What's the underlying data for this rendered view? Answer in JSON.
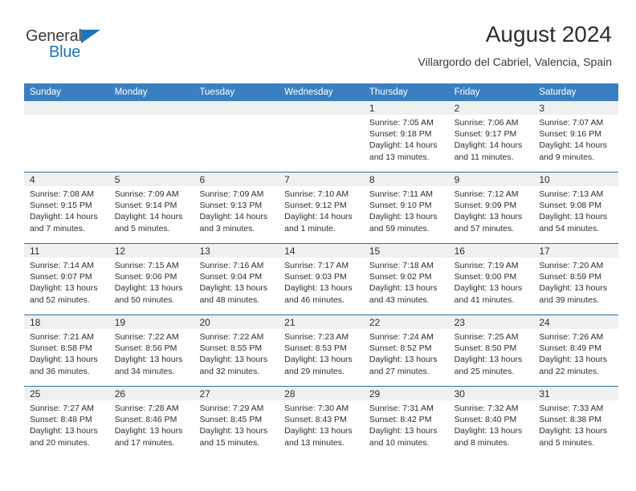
{
  "brand": {
    "name_top": "General",
    "name_bottom": "Blue",
    "triangle_color": "#1b75bb",
    "text_color": "#3d3d3d"
  },
  "header": {
    "title": "August 2024",
    "subtitle": "Villargordo del Cabriel, Valencia, Spain"
  },
  "colors": {
    "header_row_bg": "#3a7fc1",
    "header_row_text": "#ffffff",
    "daynum_band_bg": "#f0f0f0",
    "week_divider": "#2e6da4",
    "body_text": "#2f2f2f"
  },
  "weekdays": [
    "Sunday",
    "Monday",
    "Tuesday",
    "Wednesday",
    "Thursday",
    "Friday",
    "Saturday"
  ],
  "weeks": [
    [
      {
        "day": "",
        "lines": []
      },
      {
        "day": "",
        "lines": []
      },
      {
        "day": "",
        "lines": []
      },
      {
        "day": "",
        "lines": []
      },
      {
        "day": "1",
        "lines": [
          "Sunrise: 7:05 AM",
          "Sunset: 9:18 PM",
          "Daylight: 14 hours",
          "and 13 minutes."
        ]
      },
      {
        "day": "2",
        "lines": [
          "Sunrise: 7:06 AM",
          "Sunset: 9:17 PM",
          "Daylight: 14 hours",
          "and 11 minutes."
        ]
      },
      {
        "day": "3",
        "lines": [
          "Sunrise: 7:07 AM",
          "Sunset: 9:16 PM",
          "Daylight: 14 hours",
          "and 9 minutes."
        ]
      }
    ],
    [
      {
        "day": "4",
        "lines": [
          "Sunrise: 7:08 AM",
          "Sunset: 9:15 PM",
          "Daylight: 14 hours",
          "and 7 minutes."
        ]
      },
      {
        "day": "5",
        "lines": [
          "Sunrise: 7:09 AM",
          "Sunset: 9:14 PM",
          "Daylight: 14 hours",
          "and 5 minutes."
        ]
      },
      {
        "day": "6",
        "lines": [
          "Sunrise: 7:09 AM",
          "Sunset: 9:13 PM",
          "Daylight: 14 hours",
          "and 3 minutes."
        ]
      },
      {
        "day": "7",
        "lines": [
          "Sunrise: 7:10 AM",
          "Sunset: 9:12 PM",
          "Daylight: 14 hours",
          "and 1 minute."
        ]
      },
      {
        "day": "8",
        "lines": [
          "Sunrise: 7:11 AM",
          "Sunset: 9:10 PM",
          "Daylight: 13 hours",
          "and 59 minutes."
        ]
      },
      {
        "day": "9",
        "lines": [
          "Sunrise: 7:12 AM",
          "Sunset: 9:09 PM",
          "Daylight: 13 hours",
          "and 57 minutes."
        ]
      },
      {
        "day": "10",
        "lines": [
          "Sunrise: 7:13 AM",
          "Sunset: 9:08 PM",
          "Daylight: 13 hours",
          "and 54 minutes."
        ]
      }
    ],
    [
      {
        "day": "11",
        "lines": [
          "Sunrise: 7:14 AM",
          "Sunset: 9:07 PM",
          "Daylight: 13 hours",
          "and 52 minutes."
        ]
      },
      {
        "day": "12",
        "lines": [
          "Sunrise: 7:15 AM",
          "Sunset: 9:06 PM",
          "Daylight: 13 hours",
          "and 50 minutes."
        ]
      },
      {
        "day": "13",
        "lines": [
          "Sunrise: 7:16 AM",
          "Sunset: 9:04 PM",
          "Daylight: 13 hours",
          "and 48 minutes."
        ]
      },
      {
        "day": "14",
        "lines": [
          "Sunrise: 7:17 AM",
          "Sunset: 9:03 PM",
          "Daylight: 13 hours",
          "and 46 minutes."
        ]
      },
      {
        "day": "15",
        "lines": [
          "Sunrise: 7:18 AM",
          "Sunset: 9:02 PM",
          "Daylight: 13 hours",
          "and 43 minutes."
        ]
      },
      {
        "day": "16",
        "lines": [
          "Sunrise: 7:19 AM",
          "Sunset: 9:00 PM",
          "Daylight: 13 hours",
          "and 41 minutes."
        ]
      },
      {
        "day": "17",
        "lines": [
          "Sunrise: 7:20 AM",
          "Sunset: 8:59 PM",
          "Daylight: 13 hours",
          "and 39 minutes."
        ]
      }
    ],
    [
      {
        "day": "18",
        "lines": [
          "Sunrise: 7:21 AM",
          "Sunset: 8:58 PM",
          "Daylight: 13 hours",
          "and 36 minutes."
        ]
      },
      {
        "day": "19",
        "lines": [
          "Sunrise: 7:22 AM",
          "Sunset: 8:56 PM",
          "Daylight: 13 hours",
          "and 34 minutes."
        ]
      },
      {
        "day": "20",
        "lines": [
          "Sunrise: 7:22 AM",
          "Sunset: 8:55 PM",
          "Daylight: 13 hours",
          "and 32 minutes."
        ]
      },
      {
        "day": "21",
        "lines": [
          "Sunrise: 7:23 AM",
          "Sunset: 8:53 PM",
          "Daylight: 13 hours",
          "and 29 minutes."
        ]
      },
      {
        "day": "22",
        "lines": [
          "Sunrise: 7:24 AM",
          "Sunset: 8:52 PM",
          "Daylight: 13 hours",
          "and 27 minutes."
        ]
      },
      {
        "day": "23",
        "lines": [
          "Sunrise: 7:25 AM",
          "Sunset: 8:50 PM",
          "Daylight: 13 hours",
          "and 25 minutes."
        ]
      },
      {
        "day": "24",
        "lines": [
          "Sunrise: 7:26 AM",
          "Sunset: 8:49 PM",
          "Daylight: 13 hours",
          "and 22 minutes."
        ]
      }
    ],
    [
      {
        "day": "25",
        "lines": [
          "Sunrise: 7:27 AM",
          "Sunset: 8:48 PM",
          "Daylight: 13 hours",
          "and 20 minutes."
        ]
      },
      {
        "day": "26",
        "lines": [
          "Sunrise: 7:28 AM",
          "Sunset: 8:46 PM",
          "Daylight: 13 hours",
          "and 17 minutes."
        ]
      },
      {
        "day": "27",
        "lines": [
          "Sunrise: 7:29 AM",
          "Sunset: 8:45 PM",
          "Daylight: 13 hours",
          "and 15 minutes."
        ]
      },
      {
        "day": "28",
        "lines": [
          "Sunrise: 7:30 AM",
          "Sunset: 8:43 PM",
          "Daylight: 13 hours",
          "and 13 minutes."
        ]
      },
      {
        "day": "29",
        "lines": [
          "Sunrise: 7:31 AM",
          "Sunset: 8:42 PM",
          "Daylight: 13 hours",
          "and 10 minutes."
        ]
      },
      {
        "day": "30",
        "lines": [
          "Sunrise: 7:32 AM",
          "Sunset: 8:40 PM",
          "Daylight: 13 hours",
          "and 8 minutes."
        ]
      },
      {
        "day": "31",
        "lines": [
          "Sunrise: 7:33 AM",
          "Sunset: 8:38 PM",
          "Daylight: 13 hours",
          "and 5 minutes."
        ]
      }
    ]
  ]
}
